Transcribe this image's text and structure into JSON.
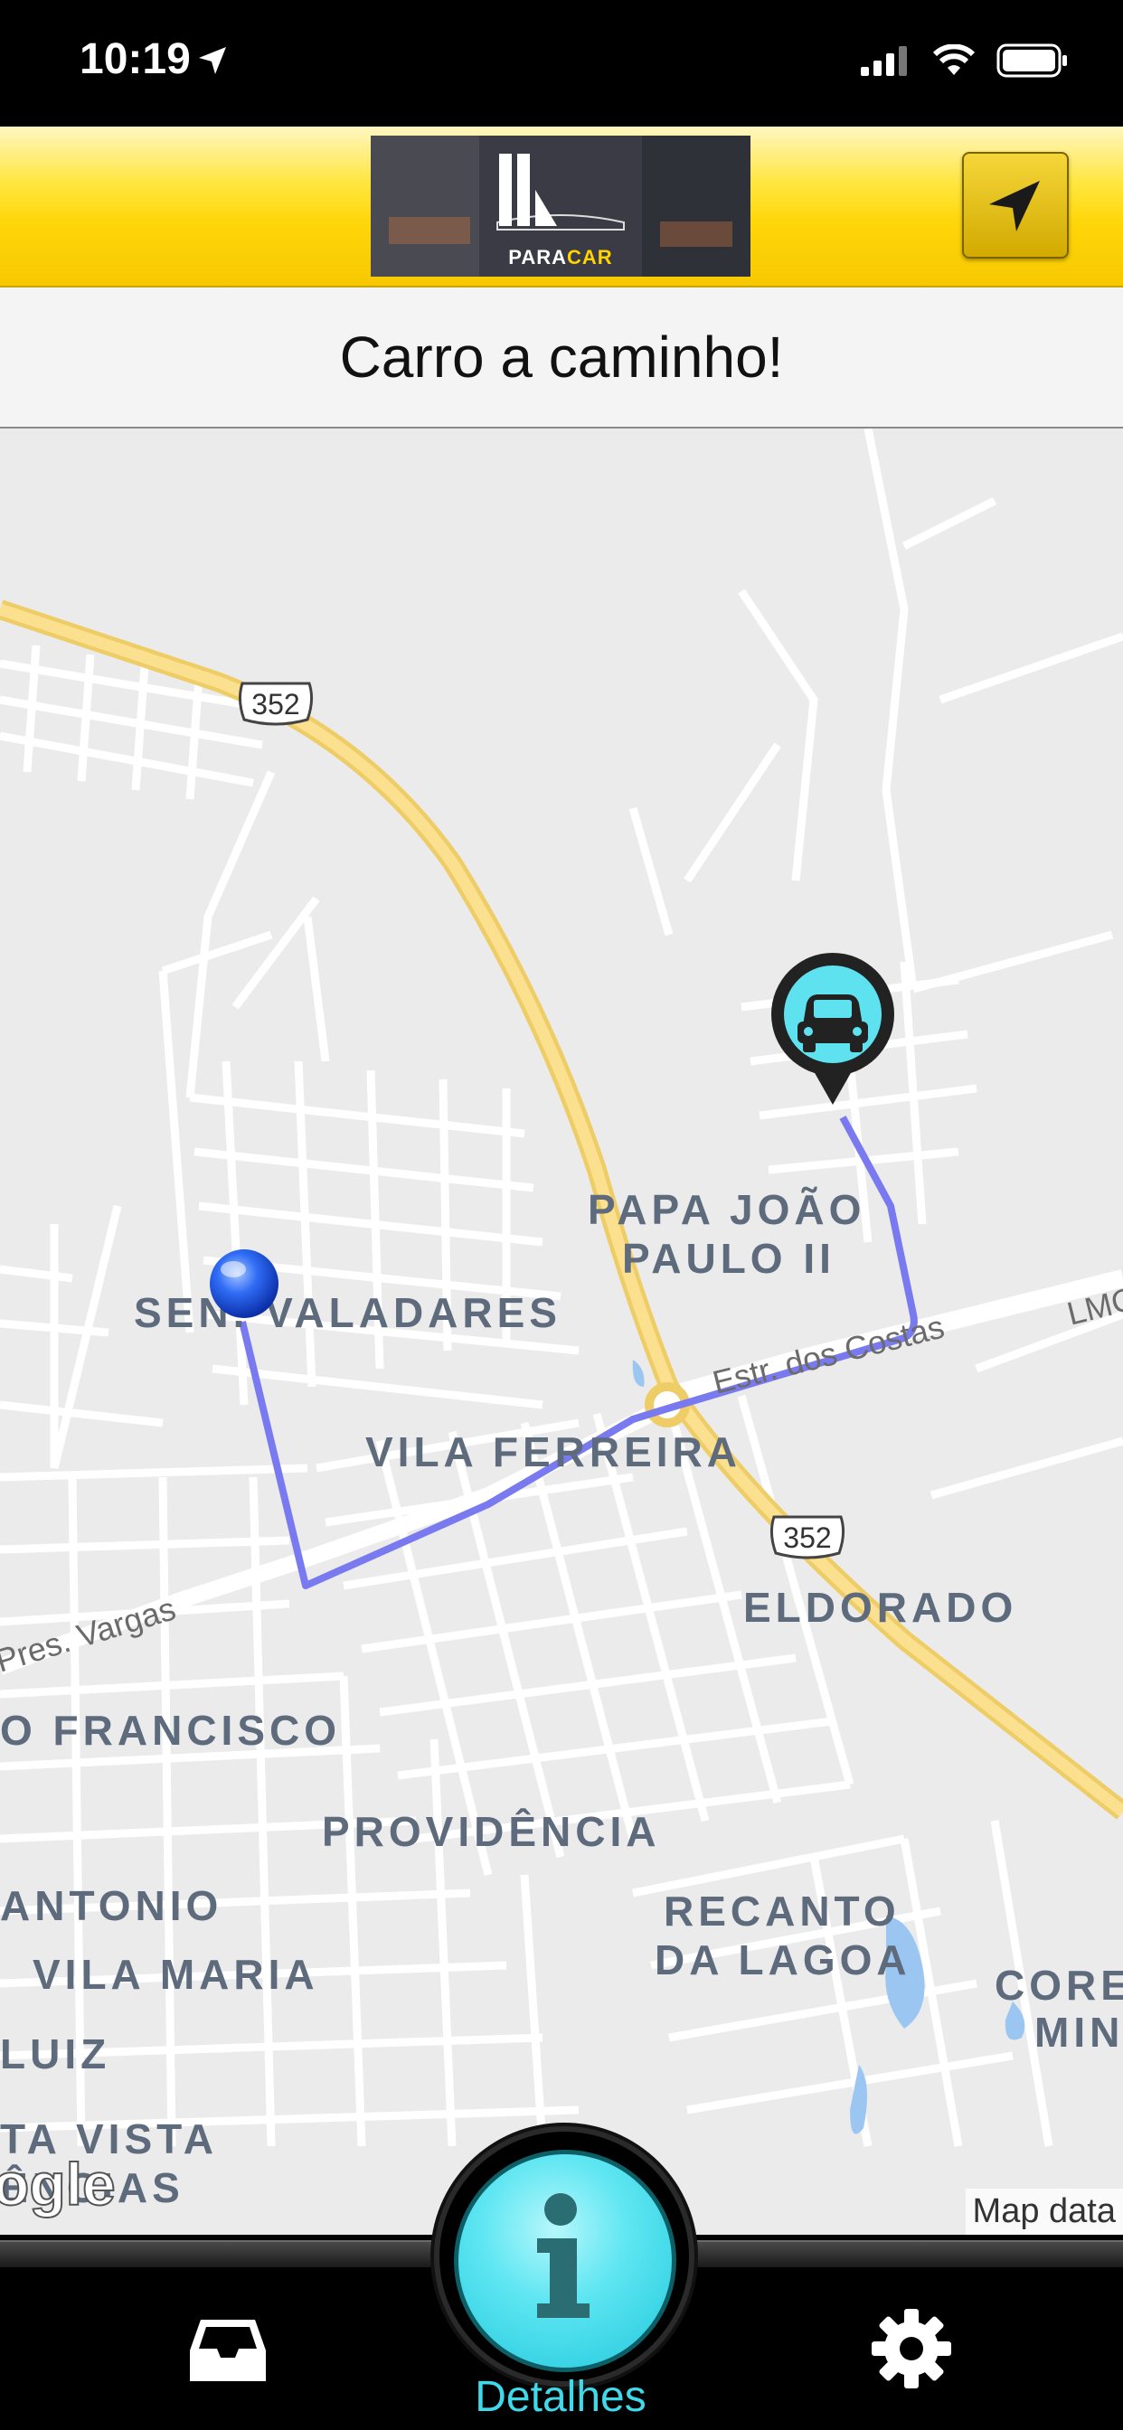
{
  "status_bar": {
    "time": "10:19",
    "icons": [
      "location-arrow-icon",
      "signal-icon",
      "wifi-icon",
      "battery-icon"
    ]
  },
  "header": {
    "logo_text_1": "PARA",
    "logo_text_2": "CAR",
    "location_button_icon": "navigation-arrow-icon"
  },
  "banner": {
    "text": "Carro a caminho!"
  },
  "map": {
    "highway_shield": "352",
    "highway_shield_2": "352",
    "neighborhoods": {
      "sen_valadares": "SEN. VALADARES",
      "papa_line1": "PAPA JOÃO",
      "papa_line2": "PAULO II",
      "vila_ferreira": "VILA FERREIRA",
      "eldorado": "ELDORADO",
      "sao_francisco": "O FRANCISCO",
      "providencia": "PROVIDÊNCIA",
      "antonio": "ANTONIO",
      "vila_maria": "VILA MARIA",
      "recanto_line1": "RECANTO",
      "recanto_line2": "DA LAGOA",
      "luiz": "LUIZ",
      "corre_line1": "CORE",
      "corre_line2": "MIN",
      "vista_line1": "TA VISTA",
      "vista_line2": "ÊNCIAS"
    },
    "roads": {
      "estr_costas": "Estr. dos Costas",
      "pres_vargas": "Pres. Vargas",
      "lmo": "LMO"
    },
    "attribution": "Map data",
    "google": "ogle",
    "markers": [
      "user-location-pin",
      "car-pin"
    ],
    "route_color": "#7a7af0"
  },
  "tabbar": {
    "left_icon": "inbox-icon",
    "center_icon": "info-icon",
    "center_label": "Detalhes",
    "right_icon": "gear-icon"
  },
  "colors": {
    "header_yellow": "#ffd60a",
    "accent_cyan": "#3fd9ea",
    "highway": "#f5d77a"
  }
}
